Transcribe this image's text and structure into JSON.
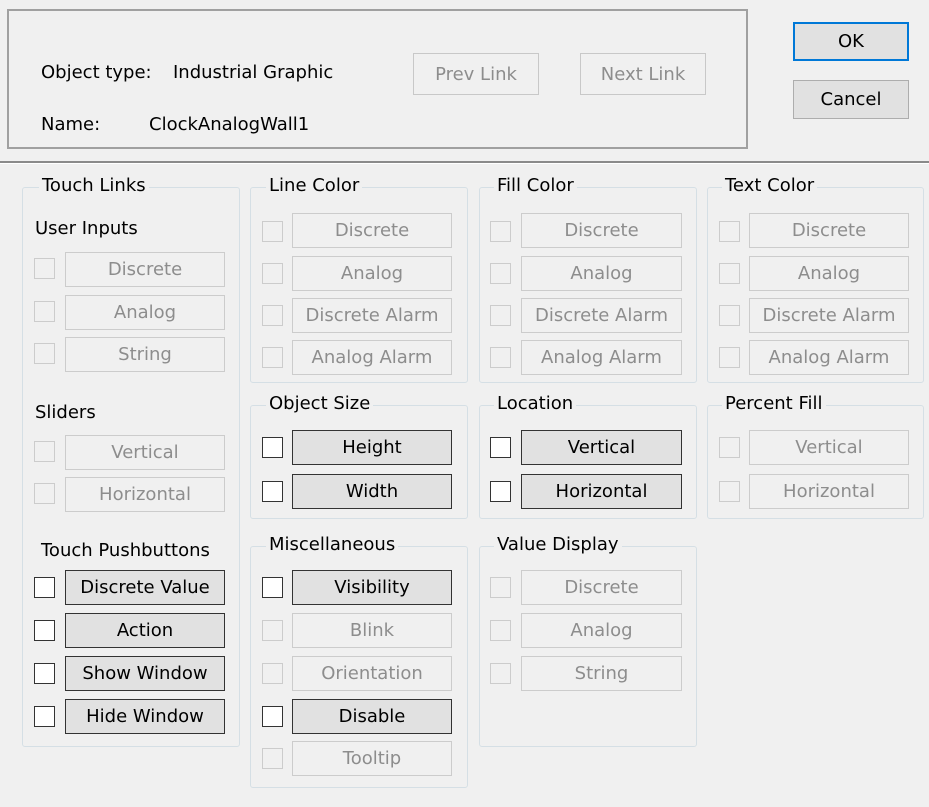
{
  "header": {
    "object_type_label": "Object type:",
    "object_type_value": "Industrial Graphic",
    "name_label": "Name:",
    "name_value": "ClockAnalogWall1",
    "prev_link": "Prev Link",
    "next_link": "Next Link",
    "ok": "OK",
    "cancel": "Cancel"
  },
  "touch_links": {
    "title": "Touch Links",
    "user_inputs": {
      "label": "User Inputs",
      "items": [
        "Discrete",
        "Analog",
        "String"
      ]
    },
    "sliders": {
      "label": "Sliders",
      "items": [
        "Vertical",
        "Horizontal"
      ]
    },
    "touch_pushbuttons": {
      "label": "Touch Pushbuttons",
      "items": [
        "Discrete Value",
        "Action",
        "Show Window",
        "Hide Window"
      ]
    }
  },
  "line_color": {
    "title": "Line Color",
    "items": [
      "Discrete",
      "Analog",
      "Discrete Alarm",
      "Analog Alarm"
    ]
  },
  "fill_color": {
    "title": "Fill Color",
    "items": [
      "Discrete",
      "Analog",
      "Discrete Alarm",
      "Analog Alarm"
    ]
  },
  "text_color": {
    "title": "Text Color",
    "items": [
      "Discrete",
      "Analog",
      "Discrete Alarm",
      "Analog Alarm"
    ]
  },
  "object_size": {
    "title": "Object Size",
    "items": [
      "Height",
      "Width"
    ]
  },
  "location": {
    "title": "Location",
    "items": [
      "Vertical",
      "Horizontal"
    ]
  },
  "percent_fill": {
    "title": "Percent Fill",
    "items": [
      "Vertical",
      "Horizontal"
    ]
  },
  "miscellaneous": {
    "title": "Miscellaneous",
    "items": [
      "Visibility",
      "Blink",
      "Orientation",
      "Disable",
      "Tooltip"
    ]
  },
  "value_display": {
    "title": "Value Display",
    "items": [
      "Discrete",
      "Analog",
      "String"
    ]
  },
  "colors": {
    "background": "#f0f0f0",
    "default_button_border": "#0078d7",
    "disabled_text": "#8d8d8d"
  }
}
